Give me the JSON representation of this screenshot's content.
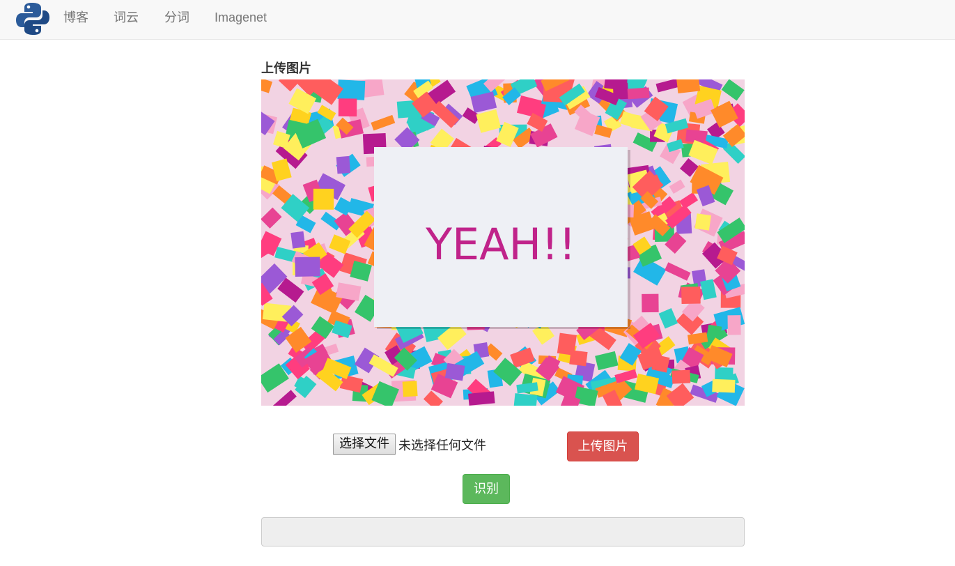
{
  "navbar": {
    "logo": "python-logo-icon",
    "links": [
      "博客",
      "词云",
      "分词",
      "Imagenet"
    ]
  },
  "main": {
    "title": "上传图片",
    "preview_text": "YEAH!!",
    "file_input": {
      "button_label": "选择文件",
      "status": "未选择任何文件"
    },
    "upload_button": "上传图片",
    "recognize_button": "识别",
    "result_value": ""
  },
  "colors": {
    "navbar_bg": "#f8f8f8",
    "danger": "#d9534f",
    "success": "#5cb85c",
    "preview_text": "#c0238a"
  }
}
